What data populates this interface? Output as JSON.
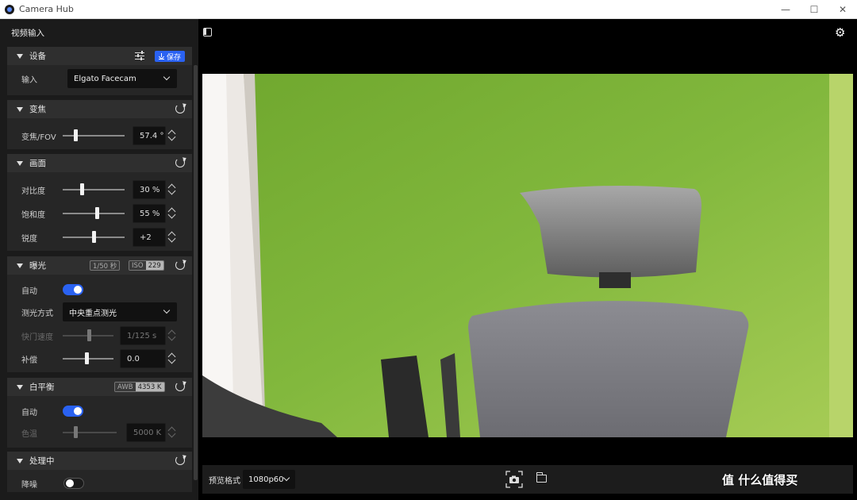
{
  "window": {
    "title": "Camera Hub",
    "minimize": "—",
    "maximize": "☐",
    "close": "✕"
  },
  "sidebar": {
    "header": "视频输入",
    "device": {
      "title": "设备",
      "save_label": "保存",
      "input_label": "输入",
      "input_value": "Elgato Facecam"
    },
    "zoom": {
      "title": "变焦",
      "fov_label": "变焦/FOV",
      "fov_value": "57.4 °"
    },
    "picture": {
      "title": "画面",
      "contrast_label": "对比度",
      "contrast_value": "30 %",
      "saturation_label": "饱和度",
      "saturation_value": "55 %",
      "sharpness_label": "锐度",
      "sharpness_value": "+2"
    },
    "exposure": {
      "title": "曝光",
      "shutter_badge": "1/50 秒",
      "iso_key": "ISO",
      "iso_value": "229",
      "auto_label": "自动",
      "auto_on": true,
      "metering_label": "测光方式",
      "metering_value": "中央重点测光",
      "shutter_label": "快门速度",
      "shutter_value": "1/125 s",
      "compensation_label": "补偿",
      "compensation_value": "0.0"
    },
    "white_balance": {
      "title": "白平衡",
      "awb_key": "AWB",
      "awb_value": "4353 K",
      "auto_label": "自动",
      "auto_on": true,
      "temperature_label": "色温",
      "temperature_value": "5000 K"
    },
    "processing": {
      "title": "处理中",
      "noise_label": "降噪",
      "noise_on": false
    }
  },
  "bottom_bar": {
    "format_label": "预览格式",
    "format_value": "1080p60",
    "watermark": "值 什么值得买"
  },
  "colors": {
    "accent": "#2a62f2",
    "panel": "#262626",
    "section_header": "#2f2f2f"
  }
}
